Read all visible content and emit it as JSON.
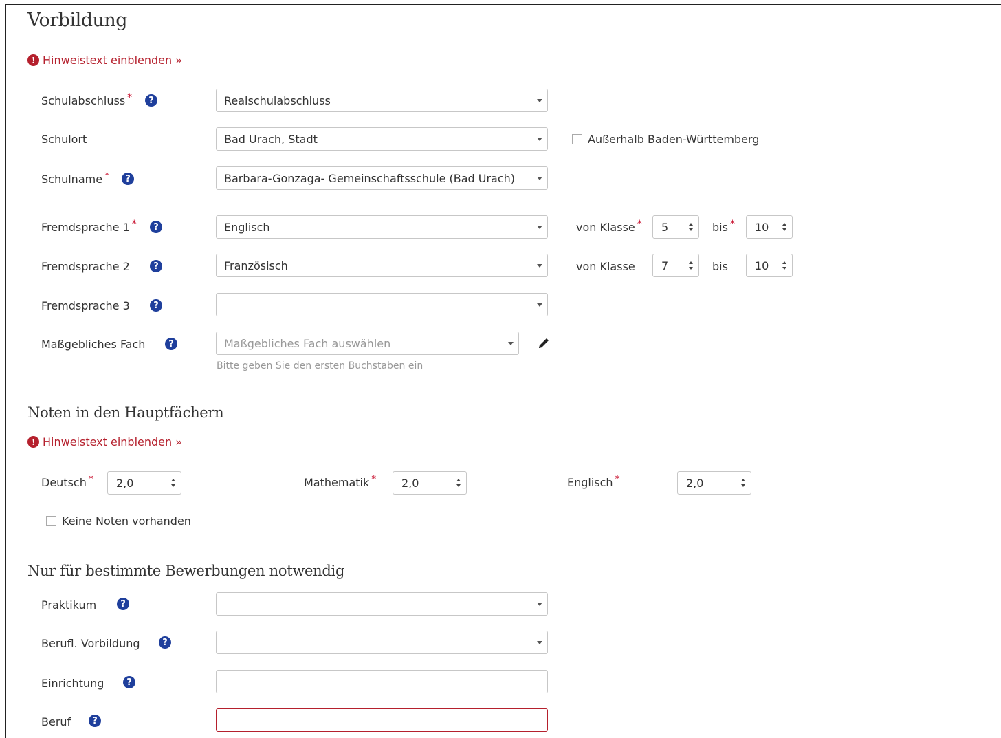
{
  "section1": {
    "title": "Vorbildung",
    "hint": "Hinweistext einblenden »",
    "schulabschluss": {
      "label": "Schulabschluss",
      "value": "Realschulabschluss"
    },
    "schulort": {
      "label": "Schulort",
      "value": "Bad Urach, Stadt",
      "checkbox": "Außerhalb Baden-Württemberg"
    },
    "schulname": {
      "label": "Schulname",
      "value": "Barbara-Gonzaga- Gemeinschaftsschule (Bad Urach)"
    },
    "fremdsprache1": {
      "label": "Fremdsprache 1",
      "value": "Englisch",
      "von_label": "von Klasse",
      "von": "5",
      "bis_label": "bis",
      "bis": "10"
    },
    "fremdsprache2": {
      "label": "Fremdsprache 2",
      "value": "Französisch",
      "von_label": "von Klasse",
      "von": "7",
      "bis_label": "bis",
      "bis": "10"
    },
    "fremdsprache3": {
      "label": "Fremdsprache 3",
      "value": ""
    },
    "fach": {
      "label": "Maßgebliches Fach",
      "placeholder": "Maßgebliches Fach auswählen",
      "note": "Bitte geben Sie den ersten Buchstaben ein"
    }
  },
  "section2": {
    "title": "Noten in den Hauptfächern",
    "hint": "Hinweistext einblenden »",
    "deutsch": {
      "label": "Deutsch",
      "value": "2,0"
    },
    "mathematik": {
      "label": "Mathematik",
      "value": "2,0"
    },
    "englisch": {
      "label": "Englisch",
      "value": "2,0"
    },
    "keine_noten": "Keine Noten vorhanden"
  },
  "section3": {
    "title": "Nur für bestimmte Bewerbungen notwendig",
    "praktikum": {
      "label": "Praktikum",
      "value": ""
    },
    "berufl": {
      "label": "Berufl. Vorbildung",
      "value": ""
    },
    "einrichtung": {
      "label": "Einrichtung",
      "value": ""
    },
    "beruf": {
      "label": "Beruf",
      "value": ""
    }
  },
  "icons": {
    "help": "question-circle-icon",
    "hint": "exclamation-circle-icon",
    "edit": "pencil-icon"
  },
  "colors": {
    "accent": "#b5202d",
    "help": "#1f3f9c",
    "required": "#c8102e"
  }
}
